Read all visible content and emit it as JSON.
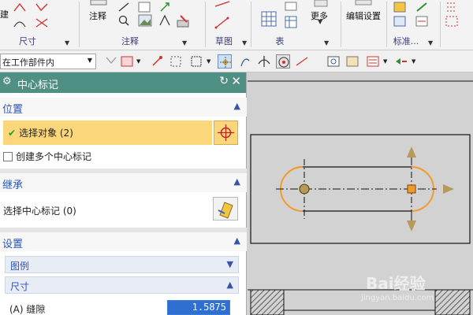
{
  "ribbon": {
    "groups": [
      {
        "label": "尺寸"
      },
      {
        "label": "注释"
      },
      {
        "label": "草图"
      },
      {
        "label": "表"
      },
      {
        "label": "标准..."
      }
    ],
    "buttons": {
      "cut_label": "建",
      "annotation": "注释",
      "more": "更多",
      "edit_settings": "编辑设置"
    }
  },
  "selection_bar": {
    "scope_dropdown": "在工作部件内"
  },
  "dialog": {
    "title": "中心标记",
    "sections": {
      "position": "位置",
      "inherit": "继承",
      "settings": "设置"
    },
    "select_object": "选择对象 (2)",
    "create_multiple": "创建多个中心标记",
    "select_center_mark": "选择中心标记 (0)",
    "subsections": {
      "legend": "图例",
      "dimension": "尺寸"
    },
    "gap_label": "(A) 缝隙",
    "gap_value": "1.5875"
  },
  "colors": {
    "title_bar": "#4f8f84",
    "section_text": "#2a55b8",
    "selected_row": "#fcd67b",
    "highlight_orange": "#f39a2c",
    "arrow_tan": "#b59a5a"
  },
  "watermark": {
    "brand": "Bai经验",
    "url": "jingyan.baidu.com"
  }
}
